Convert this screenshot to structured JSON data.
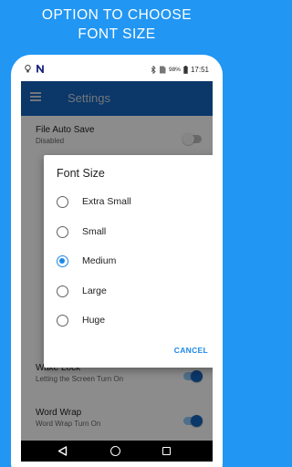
{
  "promo": {
    "line1": "OPTION TO CHOOSE",
    "line2": "FONT SIZE"
  },
  "status_bar": {
    "battery": "98%",
    "time": "17:51"
  },
  "app_bar": {
    "title": "Settings"
  },
  "settings": [
    {
      "title": "File Auto Save",
      "subtitle": "Disabled",
      "enabled": false
    },
    {
      "title": "Wake Lock",
      "subtitle": "Letting the Screen Turn On",
      "enabled": true
    },
    {
      "title": "Word Wrap",
      "subtitle": "Word Wrap Turn On",
      "enabled": true
    }
  ],
  "dialog": {
    "title": "Font Size",
    "options": [
      "Extra Small",
      "Small",
      "Medium",
      "Large",
      "Huge"
    ],
    "selected": "Medium",
    "cancel_label": "CANCEL"
  },
  "colors": {
    "background": "#2196f3",
    "app_bar": "#1565c0",
    "accent": "#1e88e5"
  },
  "icons": [
    "lightbulb-icon",
    "notification-n-icon",
    "bluetooth-icon",
    "sim-icon",
    "battery-icon",
    "menu-icon",
    "back-icon",
    "home-icon",
    "recents-icon"
  ]
}
